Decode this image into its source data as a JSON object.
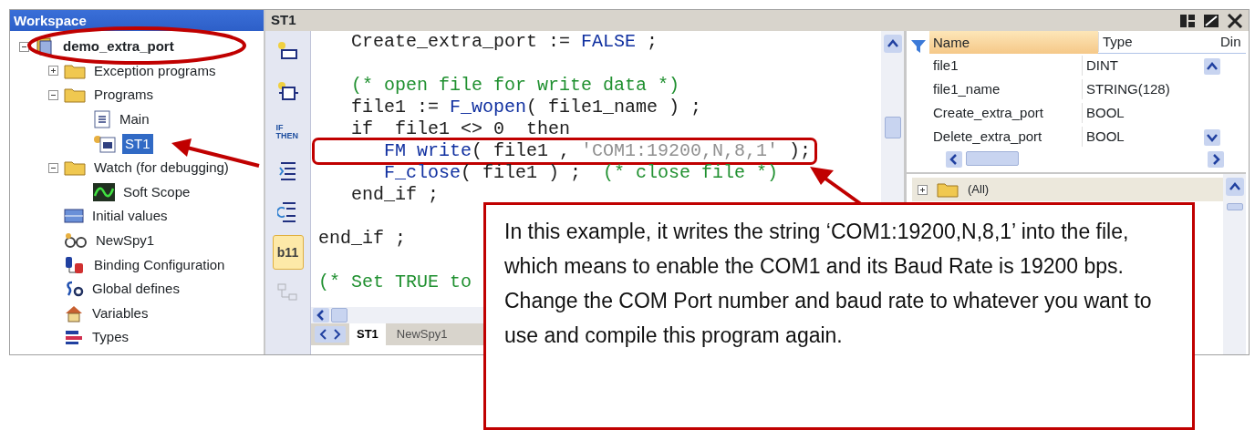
{
  "workspace": {
    "title": "Workspace",
    "tree": [
      {
        "label": "demo_extra_port",
        "kind": "project",
        "expanded": true,
        "selected": false,
        "children": [
          {
            "label": "Exception programs",
            "kind": "folder",
            "expanded": false,
            "selected": false
          },
          {
            "label": "Programs",
            "kind": "folder",
            "expanded": true,
            "selected": false,
            "children": [
              {
                "label": "Main",
                "kind": "program",
                "selected": false
              },
              {
                "label": "ST1",
                "kind": "st-program",
                "selected": true
              }
            ]
          },
          {
            "label": "Watch (for debugging)",
            "kind": "folder",
            "expanded": true,
            "selected": false,
            "children": [
              {
                "label": "Soft Scope",
                "kind": "scope",
                "selected": false
              }
            ]
          },
          {
            "label": "Initial values",
            "kind": "values",
            "selected": false
          },
          {
            "label": "NewSpy1",
            "kind": "spy",
            "selected": false
          },
          {
            "label": "Binding Configuration",
            "kind": "binding",
            "selected": false
          },
          {
            "label": "Global defines",
            "kind": "defines",
            "selected": false
          },
          {
            "label": "Variables",
            "kind": "variables",
            "selected": false
          },
          {
            "label": "Types",
            "kind": "types",
            "selected": false
          }
        ]
      }
    ]
  },
  "editor": {
    "title": "ST1",
    "toolbar": [
      {
        "kind": "step",
        "selected": false,
        "disabled": false
      },
      {
        "kind": "transition",
        "selected": false,
        "disabled": false
      },
      {
        "kind": "ifthen",
        "label": "IF THEN",
        "selected": false,
        "disabled": false
      },
      {
        "kind": "list",
        "selected": false,
        "disabled": false
      },
      {
        "kind": "loop",
        "selected": false,
        "disabled": false
      },
      {
        "kind": "bits",
        "label": "b11",
        "selected": true,
        "disabled": false
      },
      {
        "kind": "network",
        "selected": false,
        "disabled": true
      }
    ],
    "code": [
      {
        "kind": "code",
        "highlighted": false,
        "tokens": [
          {
            "text": "   Create_extra_port := ",
            "kind": "plain"
          },
          {
            "text": "FALSE",
            "kind": "keyword"
          },
          {
            "text": " ;",
            "kind": "plain"
          }
        ]
      },
      {
        "kind": "blank"
      },
      {
        "kind": "code",
        "highlighted": false,
        "tokens": [
          {
            "text": "   (* open file for write data *)",
            "kind": "comment"
          }
        ]
      },
      {
        "kind": "code",
        "highlighted": false,
        "tokens": [
          {
            "text": "   file1 := ",
            "kind": "plain"
          },
          {
            "text": "F_wopen",
            "kind": "keyword"
          },
          {
            "text": "( file1_name ) ;",
            "kind": "plain"
          }
        ]
      },
      {
        "kind": "code",
        "highlighted": false,
        "tokens": [
          {
            "text": "   if  file1 <> 0  then",
            "kind": "plain"
          }
        ]
      },
      {
        "kind": "code",
        "highlighted": true,
        "tokens": [
          {
            "text": "      FM write",
            "kind": "keyword"
          },
          {
            "text": "( file1 , ",
            "kind": "plain"
          },
          {
            "text": "'COM1:19200,N,8,1'",
            "kind": "string"
          },
          {
            "text": " );",
            "kind": "plain"
          }
        ]
      },
      {
        "kind": "code",
        "highlighted": false,
        "tokens": [
          {
            "text": "      F_close",
            "kind": "keyword"
          },
          {
            "text": "( file1 ) ;  ",
            "kind": "plain"
          },
          {
            "text": "(* close file *)",
            "kind": "comment"
          }
        ]
      },
      {
        "kind": "code",
        "highlighted": false,
        "tokens": [
          {
            "text": "   end_if ;",
            "kind": "plain"
          }
        ]
      },
      {
        "kind": "blank"
      },
      {
        "kind": "code",
        "highlighted": false,
        "tokens": [
          {
            "text": "end_if ;",
            "kind": "plain"
          }
        ]
      },
      {
        "kind": "blank"
      },
      {
        "kind": "code",
        "highlighted": false,
        "tokens": [
          {
            "text": "(* Set TRUE to",
            "kind": "comment"
          }
        ]
      }
    ],
    "tabs": [
      {
        "label": "ST1",
        "selected": true
      },
      {
        "label": "NewSpy1",
        "selected": false
      }
    ]
  },
  "variables": {
    "columns": [
      "Name",
      "Type",
      "Din"
    ],
    "rows": [
      [
        "file1",
        "DINT"
      ],
      [
        "file1_name",
        "STRING(128)"
      ],
      [
        "Create_extra_port",
        "BOOL"
      ],
      [
        "Delete_extra_port",
        "BOOL"
      ]
    ],
    "groups": [
      {
        "label": "(All)",
        "expanded": false
      }
    ]
  },
  "callout": {
    "text": "In this example, it writes the string ‘COM1:19200,N,8,1’ into the file, which means to enable the COM1 and its Baud Rate is 19200 bps. Change the COM Port number and baud rate to whatever you want to use and compile this program again."
  }
}
